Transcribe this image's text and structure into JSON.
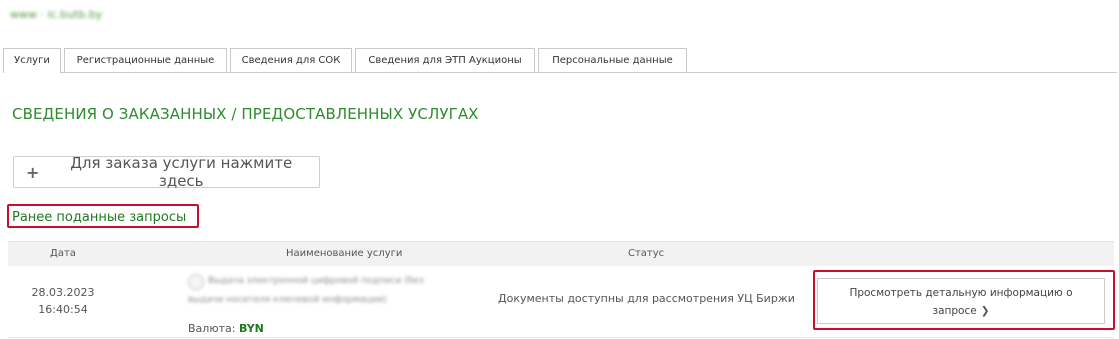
{
  "breadcrumb": "www · ic.butb.by",
  "tabs": [
    {
      "label": "Услуги",
      "active": true
    },
    {
      "label": "Регистрационные данные",
      "active": false
    },
    {
      "label": "Сведения для СОК",
      "active": false
    },
    {
      "label": "Сведения для ЭТП Аукционы",
      "active": false
    },
    {
      "label": "Персональные данные",
      "active": false
    }
  ],
  "section_title": "СВЕДЕНИЯ О ЗАКАЗАННЫХ / ПРЕДОСТАВЛЕННЫХ УСЛУГАХ",
  "order_button": {
    "icon": "plus-icon",
    "label": "Для заказа услуги нажмите здесь"
  },
  "previous_requests_label": "Ранее поданные запросы",
  "table": {
    "headers": {
      "date": "Дата",
      "service": "Наименование услуги",
      "status": "Статус"
    },
    "rows": [
      {
        "date": "28.03.2023",
        "time": "16:40:54",
        "service_line1": "Выдача электронной цифровой подписи (без",
        "service_line2": "выдачи носителя ключевой информации)",
        "currency_label": "Валюта:",
        "currency_code": "BYN",
        "status": "Документы доступны для рассмотрения УЦ Биржи",
        "detail_button": {
          "line1": "Просмотреть детальную информацию о",
          "line2": "запросе",
          "icon": "chevron-right-icon"
        }
      }
    ]
  },
  "colors": {
    "accent_green": "#2e8b2e",
    "highlight_red": "#c8102e"
  }
}
